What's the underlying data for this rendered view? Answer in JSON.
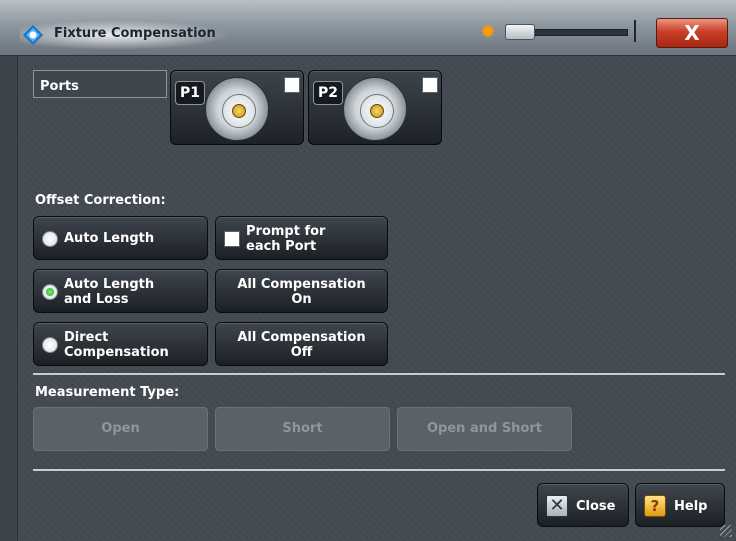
{
  "window": {
    "title": "Fixture Compensation",
    "close_glyph": "X",
    "brightness_icon": "sun-icon",
    "accent": "#c9402a"
  },
  "ports": {
    "label": "Ports",
    "items": [
      {
        "tag": "P1",
        "checked": false
      },
      {
        "tag": "P2",
        "checked": false
      }
    ]
  },
  "offset_correction": {
    "label": "Offset Correction:",
    "options": [
      {
        "line1": "Auto Length",
        "line2": "",
        "selected": false
      },
      {
        "line1": "Auto Length",
        "line2": "and Loss",
        "selected": true
      },
      {
        "line1": "Direct",
        "line2": "Compensation",
        "selected": false
      }
    ],
    "prompt": {
      "line1": "Prompt for",
      "line2": "each Port",
      "checked": false
    },
    "all_on": {
      "line1": "All Compensation",
      "line2": "On"
    },
    "all_off": {
      "line1": "All Compensation",
      "line2": "Off"
    }
  },
  "measurement_type": {
    "label": "Measurement Type:",
    "buttons": [
      "Open",
      "Short",
      "Open and Short"
    ]
  },
  "footer": {
    "close_label": "Close",
    "help_label": "Help"
  }
}
